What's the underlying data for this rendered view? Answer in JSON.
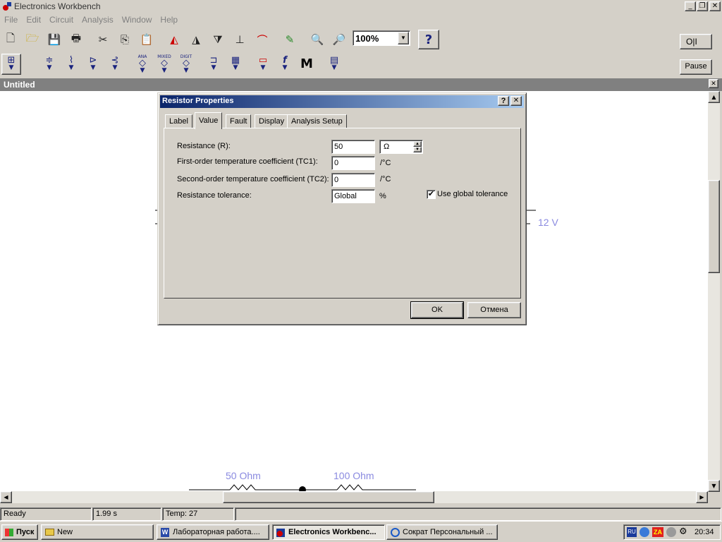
{
  "app": {
    "title": "Electronics Workbench"
  },
  "menu": [
    "File",
    "Edit",
    "Circuit",
    "Analysis",
    "Window",
    "Help"
  ],
  "toolbar": {
    "zoom": "100%",
    "power_switch": "O|I",
    "pause_label": "Pause",
    "help_glyph": "?"
  },
  "parts_bin": {
    "ana_label": "ANA",
    "mixed_label": "MIXED",
    "digit_label": "DIGIT",
    "m_label": "M",
    "f_label": "f"
  },
  "document": {
    "title": "Untitled"
  },
  "canvas": {
    "voltage_label": "12 V",
    "r1_label": "50  Ohm",
    "r2_label": "100  Ohm"
  },
  "dialog": {
    "title": "Resistor Properties",
    "tabs": [
      "Label",
      "Value",
      "Fault",
      "Display",
      "Analysis Setup"
    ],
    "active_tab": "Value",
    "fields": {
      "resistance_label": "Resistance (R):",
      "resistance_value": "50",
      "resistance_unit": "Ω",
      "tc1_label": "First-order temperature coefficient (TC1):",
      "tc1_value": "0",
      "tc1_unit": "/°C",
      "tc2_label": "Second-order temperature coefficient (TC2):",
      "tc2_value": "0",
      "tc2_unit": "/°C",
      "tolerance_label": "Resistance tolerance:",
      "tolerance_value": "Global",
      "tolerance_unit": "%",
      "use_global_label": "Use global tolerance",
      "use_global_checked": true
    },
    "ok_label": "OK",
    "cancel_label": "Отмена"
  },
  "status": {
    "ready": "Ready",
    "time": "1.99 s",
    "temp": "Temp:  27"
  },
  "taskbar": {
    "start_label": "Пуск",
    "tasks": [
      "New",
      "Лабораторная работа....",
      "Electronics Workbenc...",
      "Сократ Персональный ..."
    ],
    "active_task": 2,
    "tray_lang": "RU",
    "clock": "20:34"
  },
  "colors": {
    "title_gradient_start": "#0a246a",
    "title_gradient_end": "#a6caf0",
    "canvas_label": "#8a8ae0"
  }
}
